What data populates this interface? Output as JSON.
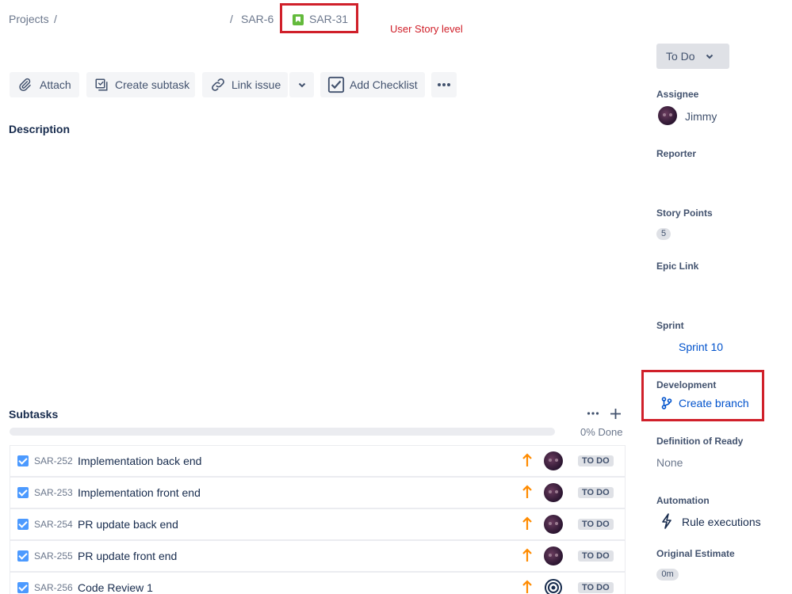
{
  "breadcrumb": {
    "projects": "Projects",
    "sep1": "/",
    "sep2": "/",
    "parent": "SAR-6",
    "current": "SAR-31",
    "current_icon": "story-icon"
  },
  "annotation": "User Story level",
  "toolbar": {
    "attach": "Attach",
    "create_subtask": "Create subtask",
    "link_issue": "Link issue",
    "add_checklist": "Add Checklist"
  },
  "description": {
    "title": "Description"
  },
  "status": {
    "label": "To Do"
  },
  "sidebar": {
    "assignee_label": "Assignee",
    "assignee_name": "Jimmy",
    "reporter_label": "Reporter",
    "story_points_label": "Story Points",
    "story_points_value": "5",
    "epic_link_label": "Epic Link",
    "sprint_label": "Sprint",
    "sprint_value": "Sprint 10",
    "development_label": "Development",
    "create_branch": "Create branch",
    "dor_label": "Definition of Ready",
    "dor_value": "None",
    "automation_label": "Automation",
    "rule_executions": "Rule executions",
    "original_estimate_label": "Original Estimate",
    "original_estimate_value": "0m"
  },
  "subtasks": {
    "title": "Subtasks",
    "progress_label": "0% Done",
    "progress": 0,
    "items": [
      {
        "key": "SAR-252",
        "summary": "Implementation back end",
        "status": "TO DO",
        "priority": "high"
      },
      {
        "key": "SAR-253",
        "summary": "Implementation front end",
        "status": "TO DO",
        "priority": "high"
      },
      {
        "key": "SAR-254",
        "summary": "PR update back end",
        "status": "TO DO",
        "priority": "high"
      },
      {
        "key": "SAR-255",
        "summary": "PR update front end",
        "status": "TO DO",
        "priority": "high"
      },
      {
        "key": "SAR-256",
        "summary": "Code Review 1",
        "status": "TO DO",
        "priority": "high"
      }
    ]
  },
  "colors": {
    "highlight": "#d0202a",
    "link": "#0052cc",
    "priority_high": "#ff8b00",
    "story": "#63ba3c"
  }
}
